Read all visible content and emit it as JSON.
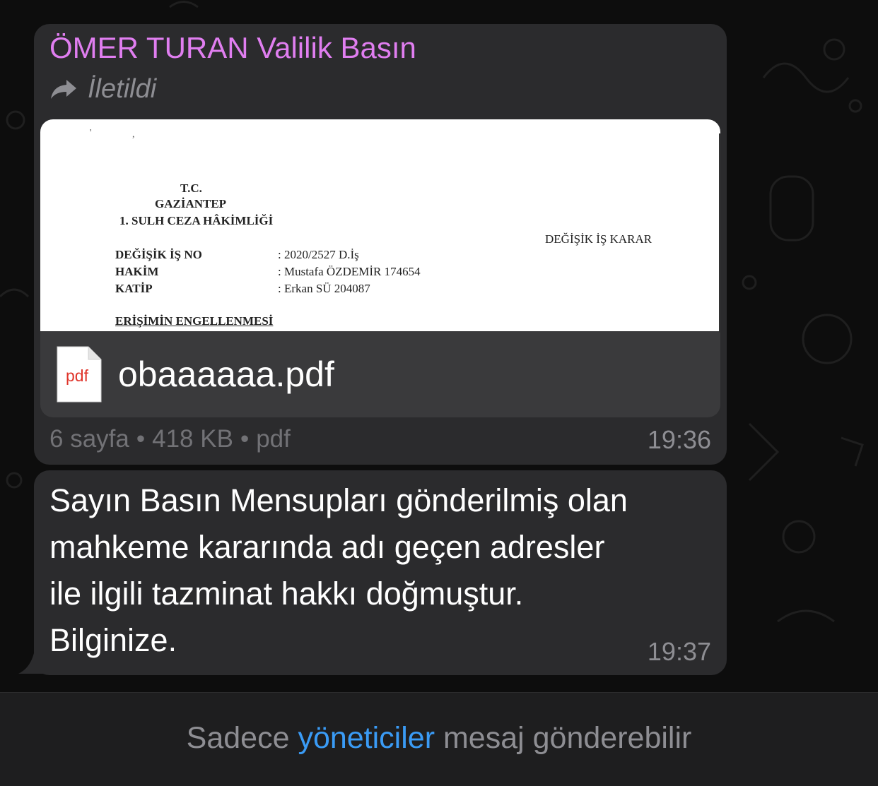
{
  "chat": {
    "sender_name": "ÖMER TURAN Valilik Basın",
    "forwarded_label": "İletildi",
    "document": {
      "preview": {
        "line1": "T.C.",
        "line2": "GAZİANTEP",
        "line3": "1. SULH CEZA HÂKİMLİĞİ",
        "decision_title": "DEĞİŞİK İŞ KARAR",
        "case_no_label": "DEĞİŞİK İŞ NO",
        "case_no_value": ": 2020/2527 D.İş",
        "judge_label": "HAKİM",
        "judge_value": ": Mustafa ÖZDEMİR  174654",
        "clerk_label": "KATİP",
        "clerk_value": ": Erkan SÜ  204087",
        "subject": "ERİŞİMİN ENGELLENMESİ"
      },
      "file_icon_text": "pdf",
      "filename": "obaaaaaa.pdf",
      "meta_pages": "6 sayfa",
      "meta_size": "418 KB",
      "meta_type": "pdf",
      "separator": "•",
      "time": "19:36"
    },
    "text_message": {
      "line1": "Sayın Basın Mensupları gönderilmiş olan",
      "line2": "mahkeme kararında adı geçen adresler",
      "line3": "ile ilgili tazminat hakkı doğmuştur.",
      "line4": "Bilginize.",
      "time": "19:37"
    }
  },
  "footer": {
    "prefix": "Sadece",
    "link": "yöneticiler",
    "suffix": "mesaj gönderebilir"
  },
  "colors": {
    "sender": "#e07ef0",
    "link": "#3a9bf5",
    "bubble": "#2b2b2d",
    "pdf_red": "#e0352b"
  },
  "icons": [
    "forward-arrow-icon",
    "pdf-file-icon"
  ]
}
